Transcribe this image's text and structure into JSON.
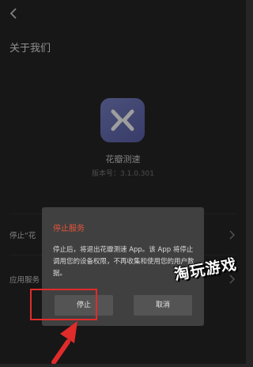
{
  "page": {
    "title": "关于我们"
  },
  "app": {
    "name": "花瓣测速",
    "version": "版本号：3.1.0.301"
  },
  "rows": [
    {
      "label": "停止“花"
    },
    {
      "label": "应用服务"
    }
  ],
  "dialog": {
    "title": "停止服务",
    "body": "停止后，将退出花瓣测速 App。该 App 将停止调用您的设备权限，不再收集和使用您的用户数据。",
    "confirm_label": "停止",
    "cancel_label": "取消"
  },
  "watermark": {
    "text": "淘玩游戏"
  },
  "colors": {
    "accent": "#e8553a",
    "highlight": "#e02b2b"
  },
  "icons": {
    "back": "back-arrow-icon",
    "chevron": "chevron-right-icon",
    "app": "app-logo-icon",
    "pointer": "pointer-arrow-icon"
  }
}
